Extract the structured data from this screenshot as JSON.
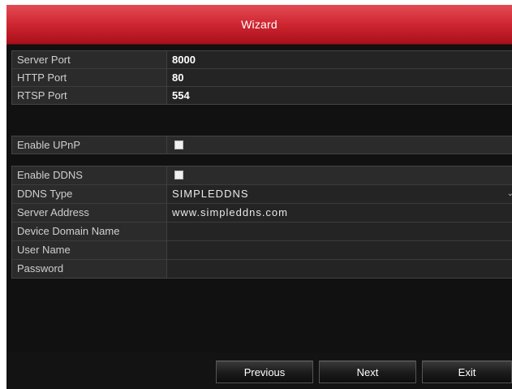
{
  "window": {
    "title": "Wizard"
  },
  "ports": {
    "server_port_label": "Server Port",
    "server_port_value": "8000",
    "http_port_label": "HTTP Port",
    "http_port_value": "80",
    "rtsp_port_label": "RTSP Port",
    "rtsp_port_value": "554"
  },
  "upnp": {
    "label": "Enable UPnP",
    "checked": false
  },
  "ddns": {
    "enable_label": "Enable DDNS",
    "enable_checked": false,
    "type_label": "DDNS Type",
    "type_value": "SIMPLEDDNS",
    "server_address_label": "Server Address",
    "server_address_value": "www.simpleddns.com",
    "domain_label": "Device Domain Name",
    "domain_value": "",
    "username_label": "User Name",
    "username_value": "",
    "password_label": "Password",
    "password_value": ""
  },
  "buttons": {
    "previous": "Previous",
    "next": "Next",
    "exit": "Exit"
  },
  "colors": {
    "title_bar": "#cf2631",
    "background": "#111111",
    "panel": "#2b2b2b"
  }
}
